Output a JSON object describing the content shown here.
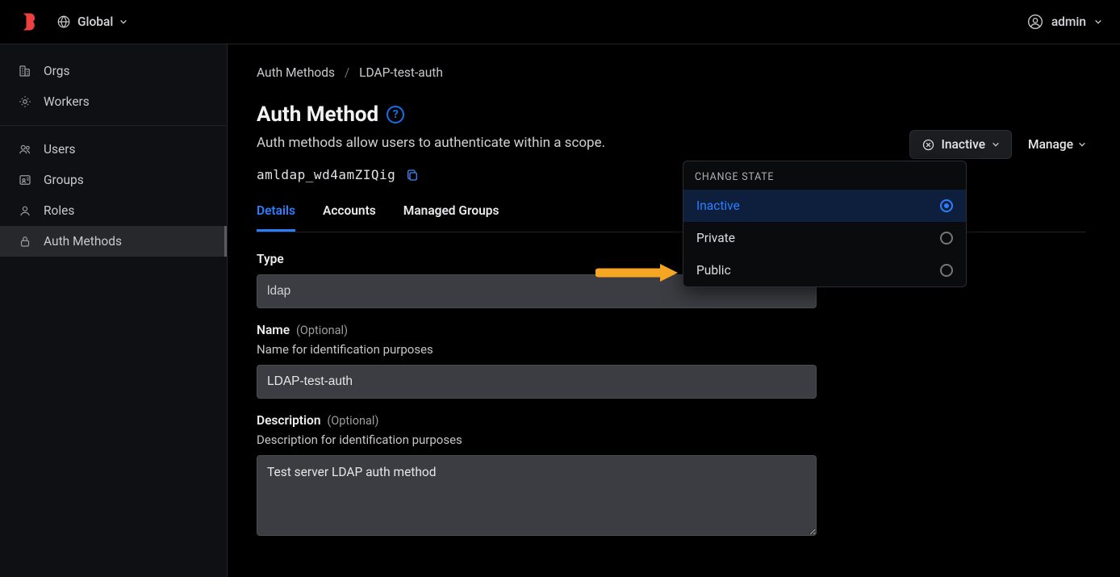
{
  "header": {
    "scope_label": "Global",
    "user_label": "admin"
  },
  "sidebar": {
    "groups": [
      [
        {
          "label": "Orgs",
          "key": "orgs"
        },
        {
          "label": "Workers",
          "key": "workers"
        }
      ],
      [
        {
          "label": "Users",
          "key": "users"
        },
        {
          "label": "Groups",
          "key": "groups"
        },
        {
          "label": "Roles",
          "key": "roles"
        },
        {
          "label": "Auth Methods",
          "key": "auth-methods",
          "active": true
        }
      ]
    ]
  },
  "breadcrumbs": {
    "root": "Auth Methods",
    "leaf": "LDAP-test-auth"
  },
  "page": {
    "title": "Auth Method",
    "subtitle": "Auth methods allow users to authenticate within a scope.",
    "id": "amldap_wd4amZIQig"
  },
  "actions": {
    "state_label": "Inactive",
    "manage_label": "Manage"
  },
  "tabs": {
    "items": [
      {
        "label": "Details",
        "active": true
      },
      {
        "label": "Accounts",
        "active": false
      },
      {
        "label": "Managed Groups",
        "active": false
      }
    ]
  },
  "form": {
    "type_label": "Type",
    "type_value": "ldap",
    "name_label": "Name",
    "name_optional": "(Optional)",
    "name_hint": "Name for identification purposes",
    "name_value": "LDAP-test-auth",
    "desc_label": "Description",
    "desc_optional": "(Optional)",
    "desc_hint": "Description for identification purposes",
    "desc_value": "Test server LDAP auth method"
  },
  "dropdown": {
    "title": "CHANGE STATE",
    "items": [
      {
        "label": "Inactive",
        "selected": true
      },
      {
        "label": "Private",
        "selected": false
      },
      {
        "label": "Public",
        "selected": false
      }
    ]
  }
}
